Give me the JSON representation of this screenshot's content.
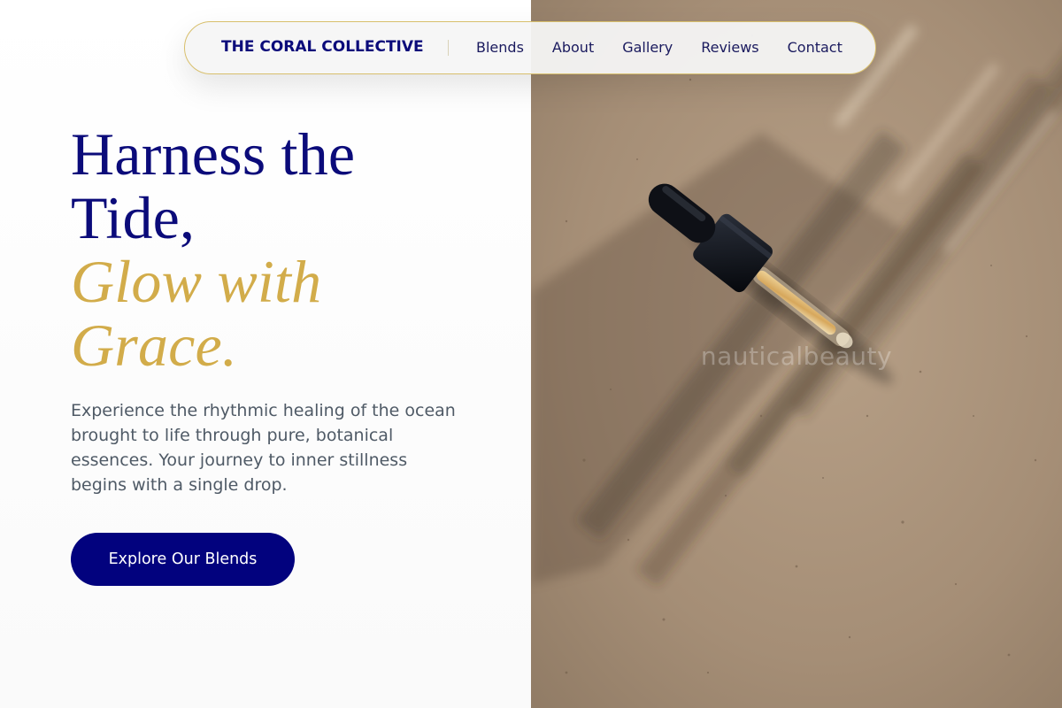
{
  "nav": {
    "brand": "THE CORAL COLLECTIVE",
    "links": [
      "Blends",
      "About",
      "Gallery",
      "Reviews",
      "Contact"
    ]
  },
  "hero": {
    "headline_line1": "Harness the",
    "headline_line2": "Tide,",
    "headline_line3": "Glow with",
    "headline_line4": "Grace.",
    "intro": "Experience the rhythmic healing of the ocean brought to life through pure, botanical essences. Your journey to inner stillness begins with a single drop.",
    "cta_label": "Explore Our Blends"
  },
  "image_panel": {
    "watermark": "nauticalbeauty",
    "subject": "dropper-bottle"
  },
  "colors": {
    "navy": "#0b0b7a",
    "gold": "#d2ac4a",
    "button": "#02027e",
    "body_text": "#4f5a66",
    "nav_border": "#d8bf6c"
  }
}
